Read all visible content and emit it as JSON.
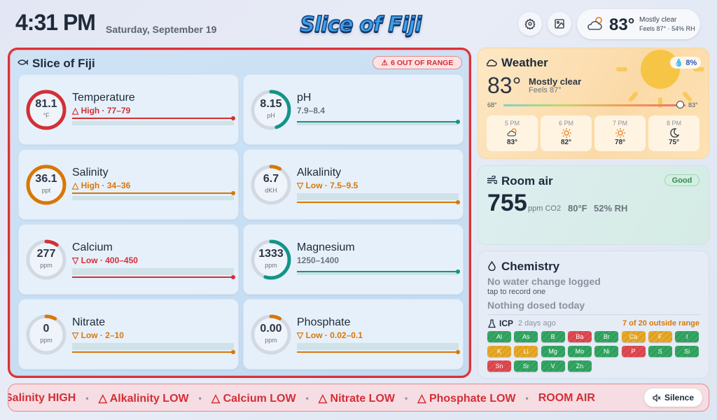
{
  "header": {
    "time": "4:31 PM",
    "date": "Saturday, September 19",
    "logo": "Slice of Fiji",
    "weather_pill": {
      "temp": "83°",
      "condition": "Mostly clear",
      "feels": "Feels 87° · 54% RH"
    }
  },
  "tank": {
    "title": "Slice of Fiji",
    "out_of_range": "6 OUT OF RANGE",
    "params": [
      {
        "name": "Temperature",
        "value": "81.1",
        "unit": "°F",
        "status": "△ High · 77–79",
        "level": "high",
        "gauge": 1.0,
        "color": "#d32f36",
        "marker": 1.0
      },
      {
        "name": "pH",
        "value": "8.15",
        "unit": "pH",
        "status": "7.9–8.4",
        "level": "ok",
        "gauge": 0.45,
        "color": "#139488",
        "marker": 1.0
      },
      {
        "name": "Salinity",
        "value": "36.1",
        "unit": "ppt",
        "status": "△ High · 34–36",
        "level": "high",
        "gauge": 1.0,
        "color": "#d97706",
        "marker": 1.0
      },
      {
        "name": "Alkalinity",
        "value": "6.7",
        "unit": "dKH",
        "status": "▽ Low · 7.5–9.5",
        "level": "low",
        "gauge": 0.08,
        "color": "#d97706",
        "marker": 1.0
      },
      {
        "name": "Calcium",
        "value": "277",
        "unit": "ppm",
        "status": "▽ Low · 400–450",
        "level": "low",
        "gauge": 0.1,
        "color": "#d32f36",
        "marker": 1.0
      },
      {
        "name": "Magnesium",
        "value": "1333",
        "unit": "ppm",
        "status": "1250–1400",
        "level": "ok",
        "gauge": 0.55,
        "color": "#139488",
        "marker": 1.0
      },
      {
        "name": "Nitrate",
        "value": "0",
        "unit": "ppm",
        "status": "▽ Low · 2–10",
        "level": "low",
        "gauge": 0.08,
        "color": "#d97706",
        "marker": 1.0
      },
      {
        "name": "Phosphate",
        "value": "0.00",
        "unit": "ppm",
        "status": "▽ Low · 0.02–0.1",
        "level": "low",
        "gauge": 0.08,
        "color": "#d97706",
        "marker": 1.0
      }
    ]
  },
  "weather": {
    "title": "Weather",
    "temp": "83°",
    "condition": "Mostly clear",
    "feels": "Feels 87°",
    "rain": "8%",
    "low": "68°",
    "high": "83°",
    "current_fraction": 0.97,
    "hours": [
      {
        "time": "5 PM",
        "icon": "partly-cloudy-icon",
        "temp": "83°"
      },
      {
        "time": "6 PM",
        "icon": "sun-icon",
        "temp": "82°"
      },
      {
        "time": "7 PM",
        "icon": "sun-icon",
        "temp": "78°"
      },
      {
        "time": "8 PM",
        "icon": "moon-icon",
        "temp": "75°"
      }
    ]
  },
  "room": {
    "title": "Room air",
    "badge": "Good",
    "co2": "755",
    "co2_unit": "ppm CO2",
    "temp": "80°F",
    "rh": "52% RH"
  },
  "chemistry": {
    "title": "Chemistry",
    "water_change": "No water change logged",
    "tap_hint": "tap to record one",
    "dosed": "Nothing dosed today",
    "icp": {
      "label": "ICP",
      "ago": "2 days ago",
      "outside": "7 of 20 outside range",
      "elements": [
        {
          "s": "Al",
          "st": "g"
        },
        {
          "s": "As",
          "st": "g"
        },
        {
          "s": "B",
          "st": "g"
        },
        {
          "s": "Ba",
          "st": "r"
        },
        {
          "s": "Br",
          "st": "g"
        },
        {
          "s": "Ca",
          "st": "y"
        },
        {
          "s": "F",
          "st": "y"
        },
        {
          "s": "I",
          "st": "g"
        },
        {
          "s": "K",
          "st": "y"
        },
        {
          "s": "Li",
          "st": "y"
        },
        {
          "s": "Mg",
          "st": "g"
        },
        {
          "s": "Mo",
          "st": "g"
        },
        {
          "s": "Ni",
          "st": "g"
        },
        {
          "s": "P",
          "st": "r"
        },
        {
          "s": "S",
          "st": "g"
        },
        {
          "s": "Si",
          "st": "g"
        },
        {
          "s": "Sn",
          "st": "r"
        },
        {
          "s": "Sr",
          "st": "g"
        },
        {
          "s": "V",
          "st": "g"
        },
        {
          "s": "Zn",
          "st": "g"
        }
      ]
    }
  },
  "ticker": {
    "items": [
      "Salinity HIGH",
      "△ Alkalinity LOW",
      "△ Calcium LOW",
      "△ Nitrate LOW",
      "△ Phosphate LOW",
      "ROOM AIR"
    ],
    "silence": "Silence"
  },
  "colors": {
    "alert": "#d32f36",
    "warn": "#d97706",
    "ok": "#139488"
  }
}
